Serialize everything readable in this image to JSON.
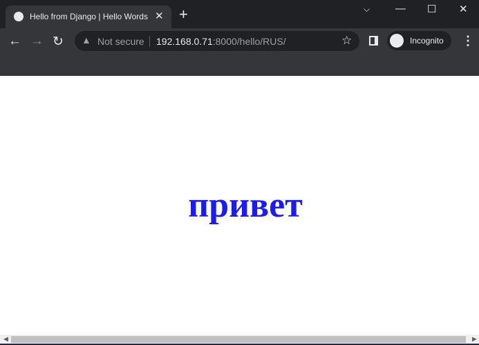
{
  "browser": {
    "tab": {
      "title": "Hello from Django | Hello Words",
      "favicon": "globe-icon"
    },
    "omnibox": {
      "security": "Not secure",
      "host": "192.168.0.71",
      "rest": ":8000/hello/RUS/"
    },
    "profile": {
      "label": "Incognito"
    }
  },
  "page": {
    "greeting": "привет",
    "greeting_color": "#1a1aff"
  }
}
